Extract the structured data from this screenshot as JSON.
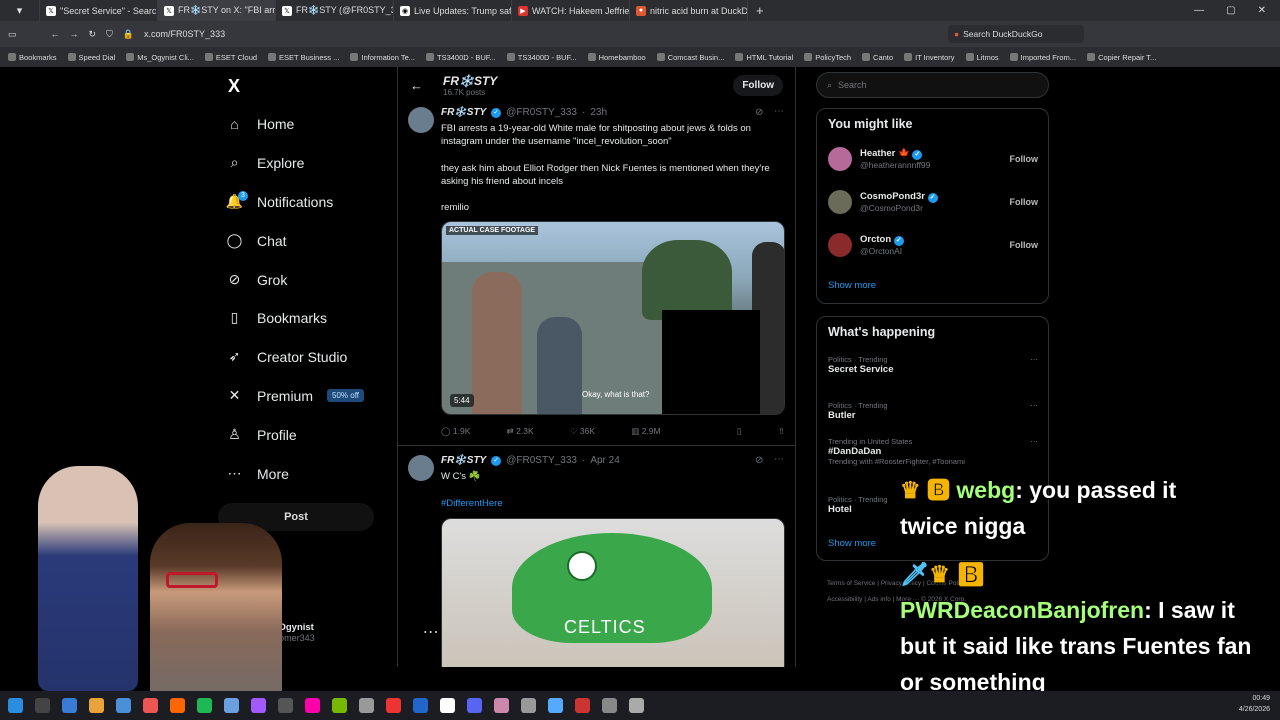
{
  "browser": {
    "tabs": [
      {
        "title": "\"Secret Service\" - Search /",
        "icon": "x-icon"
      },
      {
        "title": "FR❄️STY on X: \"FBI arrests",
        "icon": "x-icon"
      },
      {
        "title": "FR❄️STY (@FR0STY_333) /",
        "icon": "x-icon"
      },
      {
        "title": "Live Updates: Trump safe at",
        "icon": "globe-icon"
      },
      {
        "title": "WATCH: Hakeem Jeffries Vo",
        "icon": "globe-icon"
      },
      {
        "title": "nitric acid burn at DuckDuc",
        "icon": "duck-icon"
      }
    ],
    "url": "x.com/FR0STY_333",
    "search_placeholder": "Search DuckDuckGo",
    "bookmarks": [
      "Bookmarks",
      "Speed Dial",
      "Ms_Ogynist Cli...",
      "ESET Cloud",
      "ESET Business ...",
      "Information Te...",
      "TS3400D - BUF...",
      "TS3400D - BUF...",
      "Homebamboo",
      "Comcast Busin...",
      "HTML Tutorial",
      "PolicyTech",
      "Canto",
      "IT Inventory",
      "Litmos",
      "Imported From...",
      "Copier Repair T..."
    ]
  },
  "nav": {
    "logo": "X",
    "items": [
      {
        "label": "Home",
        "icon": "home-icon",
        "glyph": "⌂"
      },
      {
        "label": "Explore",
        "icon": "search-icon",
        "glyph": "⌕"
      },
      {
        "label": "Notifications",
        "icon": "bell-icon",
        "glyph": "🔔"
      },
      {
        "label": "Chat",
        "icon": "chat-icon",
        "glyph": "◯"
      },
      {
        "label": "Grok",
        "icon": "grok-icon",
        "glyph": "⊘"
      },
      {
        "label": "Bookmarks",
        "icon": "bookmark-icon",
        "glyph": "▯"
      },
      {
        "label": "Creator Studio",
        "icon": "rocket-icon",
        "glyph": "➶"
      },
      {
        "label": "Premium",
        "icon": "x-icon",
        "glyph": "✕"
      },
      {
        "label": "Profile",
        "icon": "person-icon",
        "glyph": "♙"
      },
      {
        "label": "More",
        "icon": "more-icon",
        "glyph": "⋯"
      }
    ],
    "notifications_badge": "3",
    "premium_badge": "50% off",
    "post_label": "Post",
    "account_name": "Ms_Ogynist",
    "account_handle": "@doomer343"
  },
  "profile_header": {
    "name": "FR❄️STY",
    "posts": "16.7K posts",
    "follow_label": "Follow"
  },
  "tweets": [
    {
      "name": "FR❄️STY",
      "handle": "@FR0STY_333",
      "time": "23h",
      "text1": "FBI arrests a 19-year-old White male for shitposting about jews & folds on instagram under the username \"incel_revolution_soon\"",
      "text2": "they ask him about Elliot Rodger then Nick Fuentes is mentioned when they're asking his friend about incels",
      "text3": "remilio",
      "media_label": "ACTUAL CASE FOOTAGE",
      "media_caption": "Okay, what is that?",
      "duration": "5:44",
      "replies": "1.9K",
      "reposts": "2.3K",
      "likes": "36K",
      "views": "2.9M"
    },
    {
      "name": "FR❄️STY",
      "handle": "@FR0STY_333",
      "time": "Apr 24",
      "text1": "W C's ☘️",
      "hashtag": "#DifferentHere",
      "media_text": "CELTICS"
    }
  ],
  "sidebar": {
    "search_placeholder": "Search",
    "might_like_title": "You might like",
    "suggestions": [
      {
        "name": "Heather 🍁",
        "handle": "@heatherannnff99",
        "follow": "Follow"
      },
      {
        "name": "CosmoPond3r",
        "handle": "@CosmoPond3r",
        "follow": "Follow"
      },
      {
        "name": "Orcton",
        "handle": "@OrctonAI",
        "follow": "Follow"
      }
    ],
    "show_more": "Show more",
    "happening_title": "What's happening",
    "trends": [
      {
        "meta": "Politics · Trending",
        "title": "Secret Service",
        "sub": ""
      },
      {
        "meta": "Politics · Trending",
        "title": "Butler",
        "sub": ""
      },
      {
        "meta": "Trending in United States",
        "title": "#DanDaDan",
        "sub": "Trending with #RoosterFighter, #Toonami"
      },
      {
        "meta": "Politics · Trending",
        "title": "Hotel",
        "sub": ""
      }
    ],
    "show_more_2": "Show more",
    "footer1": "Terms of Service  |  Privacy Policy  |  Cookie Policy  |",
    "footer2": "Accessibility  |  Ads info  |  More ···  © 2026 X Corp."
  },
  "chat_overlay": [
    {
      "user": "webg",
      "message": " you passed it twice nigga"
    },
    {
      "user": "PWRDeaconBanjofren",
      "message": " I saw it but it said like trans Fuentes fan or something"
    }
  ],
  "taskbar": {
    "time": "00:49",
    "date": "4/26/2026"
  }
}
